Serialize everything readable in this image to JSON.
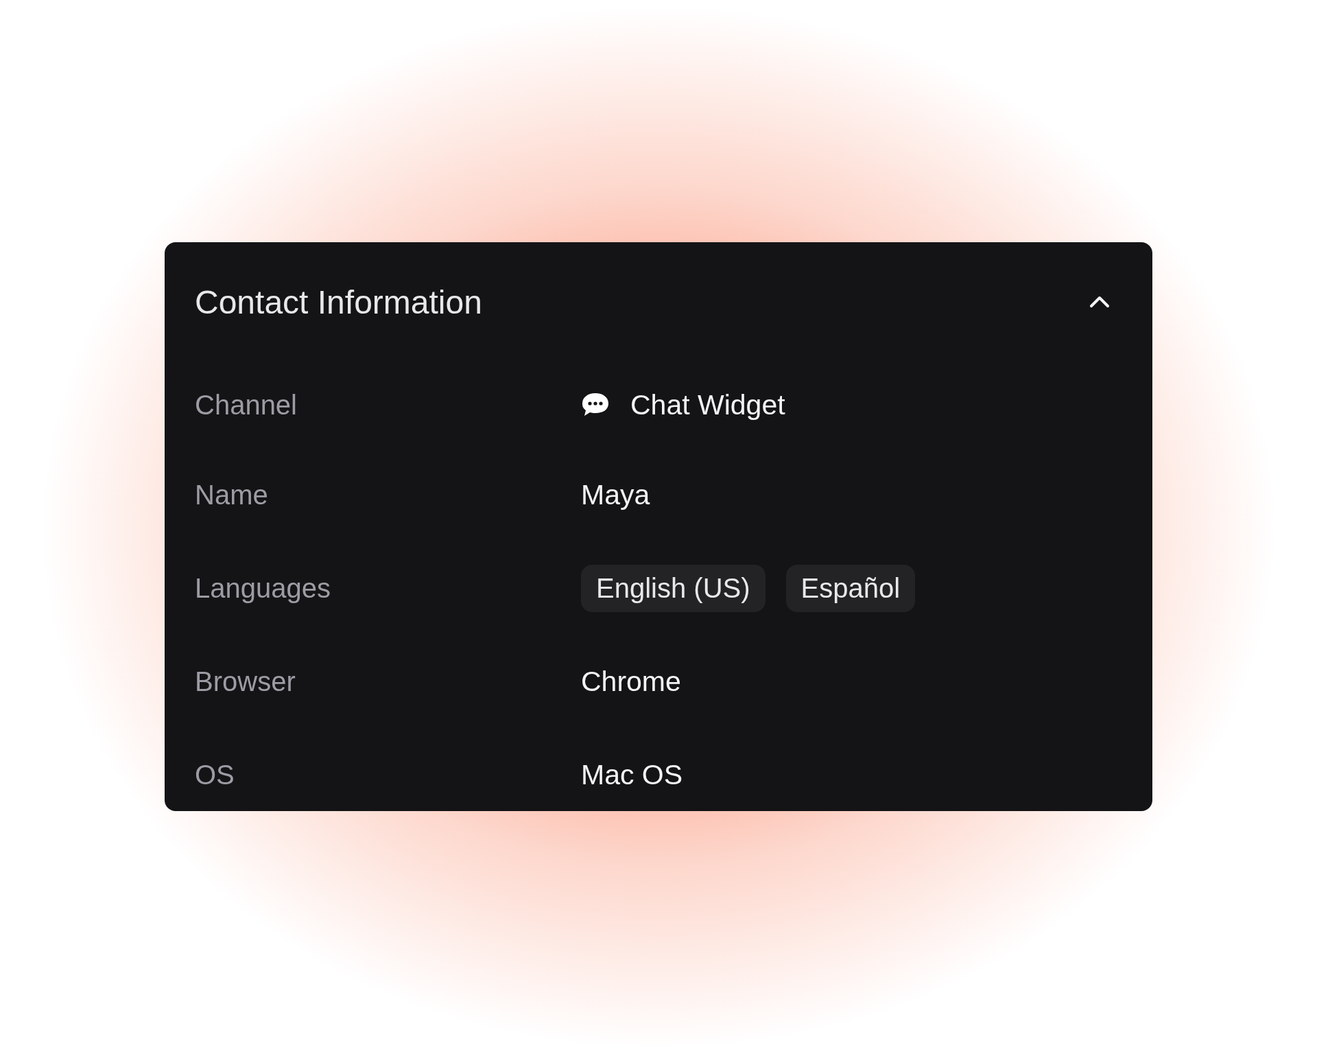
{
  "panel": {
    "title": "Contact Information",
    "expanded": true
  },
  "rows": [
    {
      "label": "Channel",
      "kind": "channel",
      "value": "Chat Widget"
    },
    {
      "label": "Name",
      "kind": "text",
      "value": "Maya"
    },
    {
      "label": "Languages",
      "kind": "tags",
      "tags": [
        "English (US)",
        "Español"
      ]
    },
    {
      "label": "Browser",
      "kind": "text",
      "value": "Chrome"
    },
    {
      "label": "OS",
      "kind": "text",
      "value": "Mac OS"
    }
  ]
}
